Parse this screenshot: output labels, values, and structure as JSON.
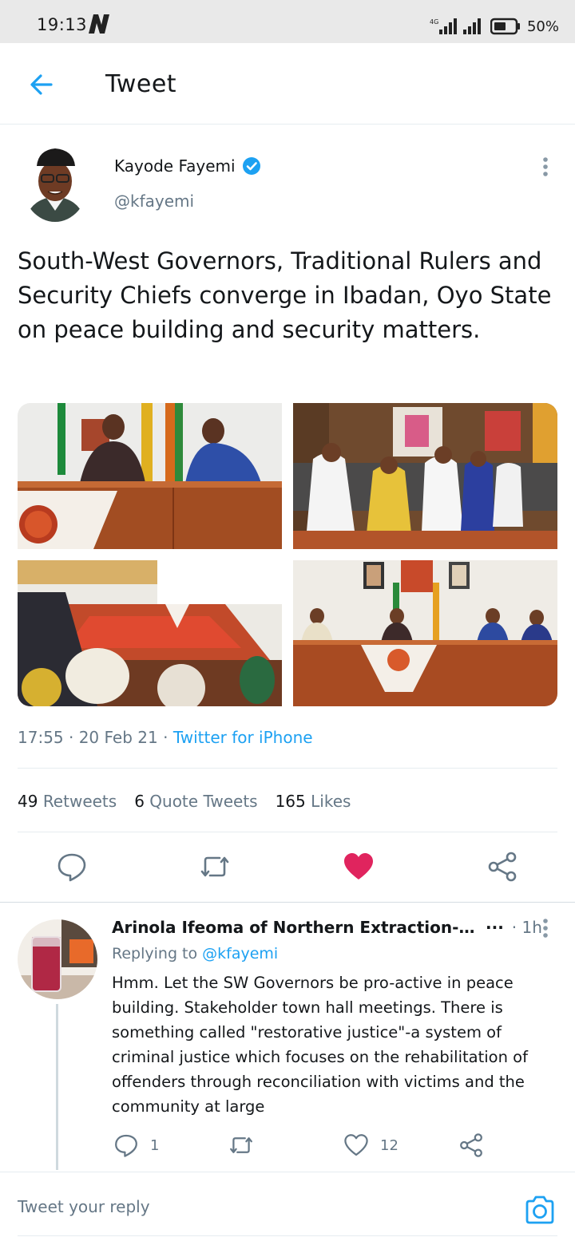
{
  "status_bar": {
    "time": "19:13",
    "network": "4G",
    "battery": "50%"
  },
  "header": {
    "title": "Tweet",
    "accent": "#1da1f2"
  },
  "tweet": {
    "author_name": "Kayode Fayemi",
    "author_handle": "@kfayemi",
    "text": "South-West Governors, Traditional Rulers and Security Chiefs converge in Ibadan, Oyo State on peace building and security matters.",
    "timestamp": "17:55 · 20 Feb 21 · ",
    "source": "Twitter for iPhone",
    "retweets_count": "49",
    "retweets_label": "Retweets",
    "quotes_count": "6",
    "quotes_label": "Quote Tweets",
    "likes_count": "165",
    "likes_label": "Likes",
    "liked": true,
    "like_color": "#e0245e",
    "photos": [
      "photo-1",
      "photo-2",
      "photo-3",
      "photo-4"
    ]
  },
  "reply": {
    "author_name": "Arinola Ifeoma of Northern Extraction-All",
    "ellipsis": "···",
    "time": "· 1h",
    "replying_prefix": "Replying to ",
    "replying_handle": "@kfayemi",
    "text": "Hmm. Let the SW Governors be pro-active in peace building. Stakeholder town hall meetings. There is something called \"restorative justice\"-a system of criminal justice which focuses on the rehabilitation of offenders through reconciliation with victims and the community at large",
    "reply_count": "1",
    "like_count": "12"
  },
  "composer": {
    "placeholder": "Tweet your reply"
  },
  "icons": [
    "back-arrow-icon",
    "verified-badge-icon",
    "more-vertical-icon",
    "comment-icon",
    "retweet-icon",
    "heart-icon",
    "share-icon",
    "camera-icon"
  ]
}
